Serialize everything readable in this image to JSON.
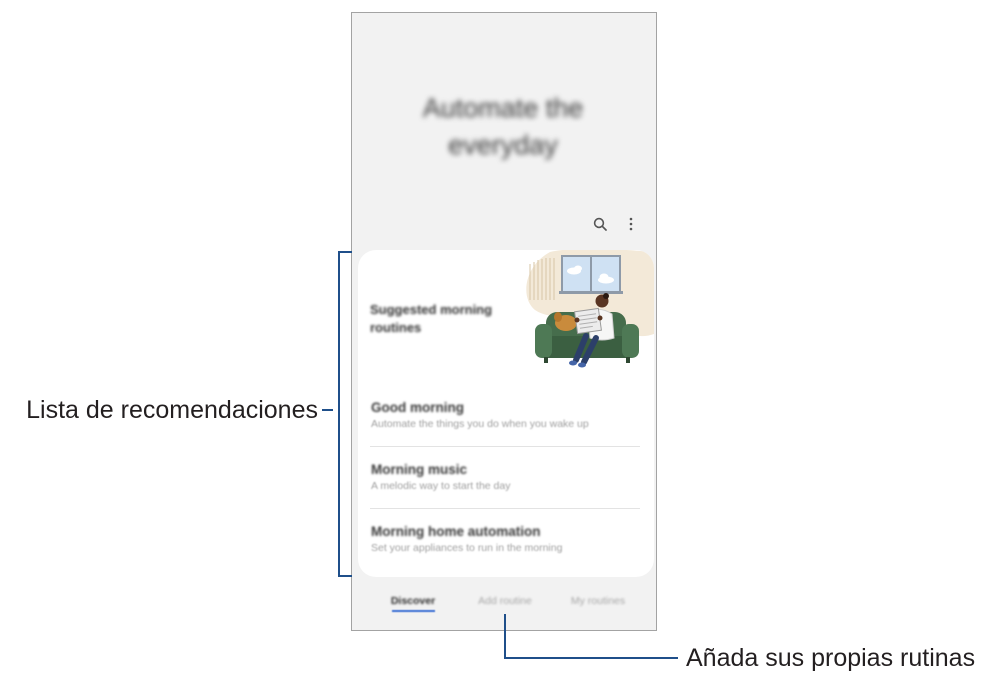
{
  "phone": {
    "hero_title": "Automate the everyday",
    "icons": {
      "search": "search-icon",
      "more": "more-vertical-icon"
    },
    "card": {
      "heading": "Suggested morning routines",
      "items": [
        {
          "title": "Good morning",
          "subtitle": "Automate the things you do when you wake up"
        },
        {
          "title": "Morning music",
          "subtitle": "A melodic way to start the day"
        },
        {
          "title": "Morning home automation",
          "subtitle": "Set your appliances to run in the morning"
        }
      ]
    },
    "bottom_nav": {
      "tabs": [
        "Discover",
        "Add routine",
        "My routines"
      ],
      "active_index": 0
    },
    "accent_color": "#3b6fd4"
  },
  "annotations": {
    "recommendations_label": "Lista de recomendaciones",
    "add_routines_label": "Añada sus propias rutinas",
    "line_color": "#1f4f8a"
  }
}
